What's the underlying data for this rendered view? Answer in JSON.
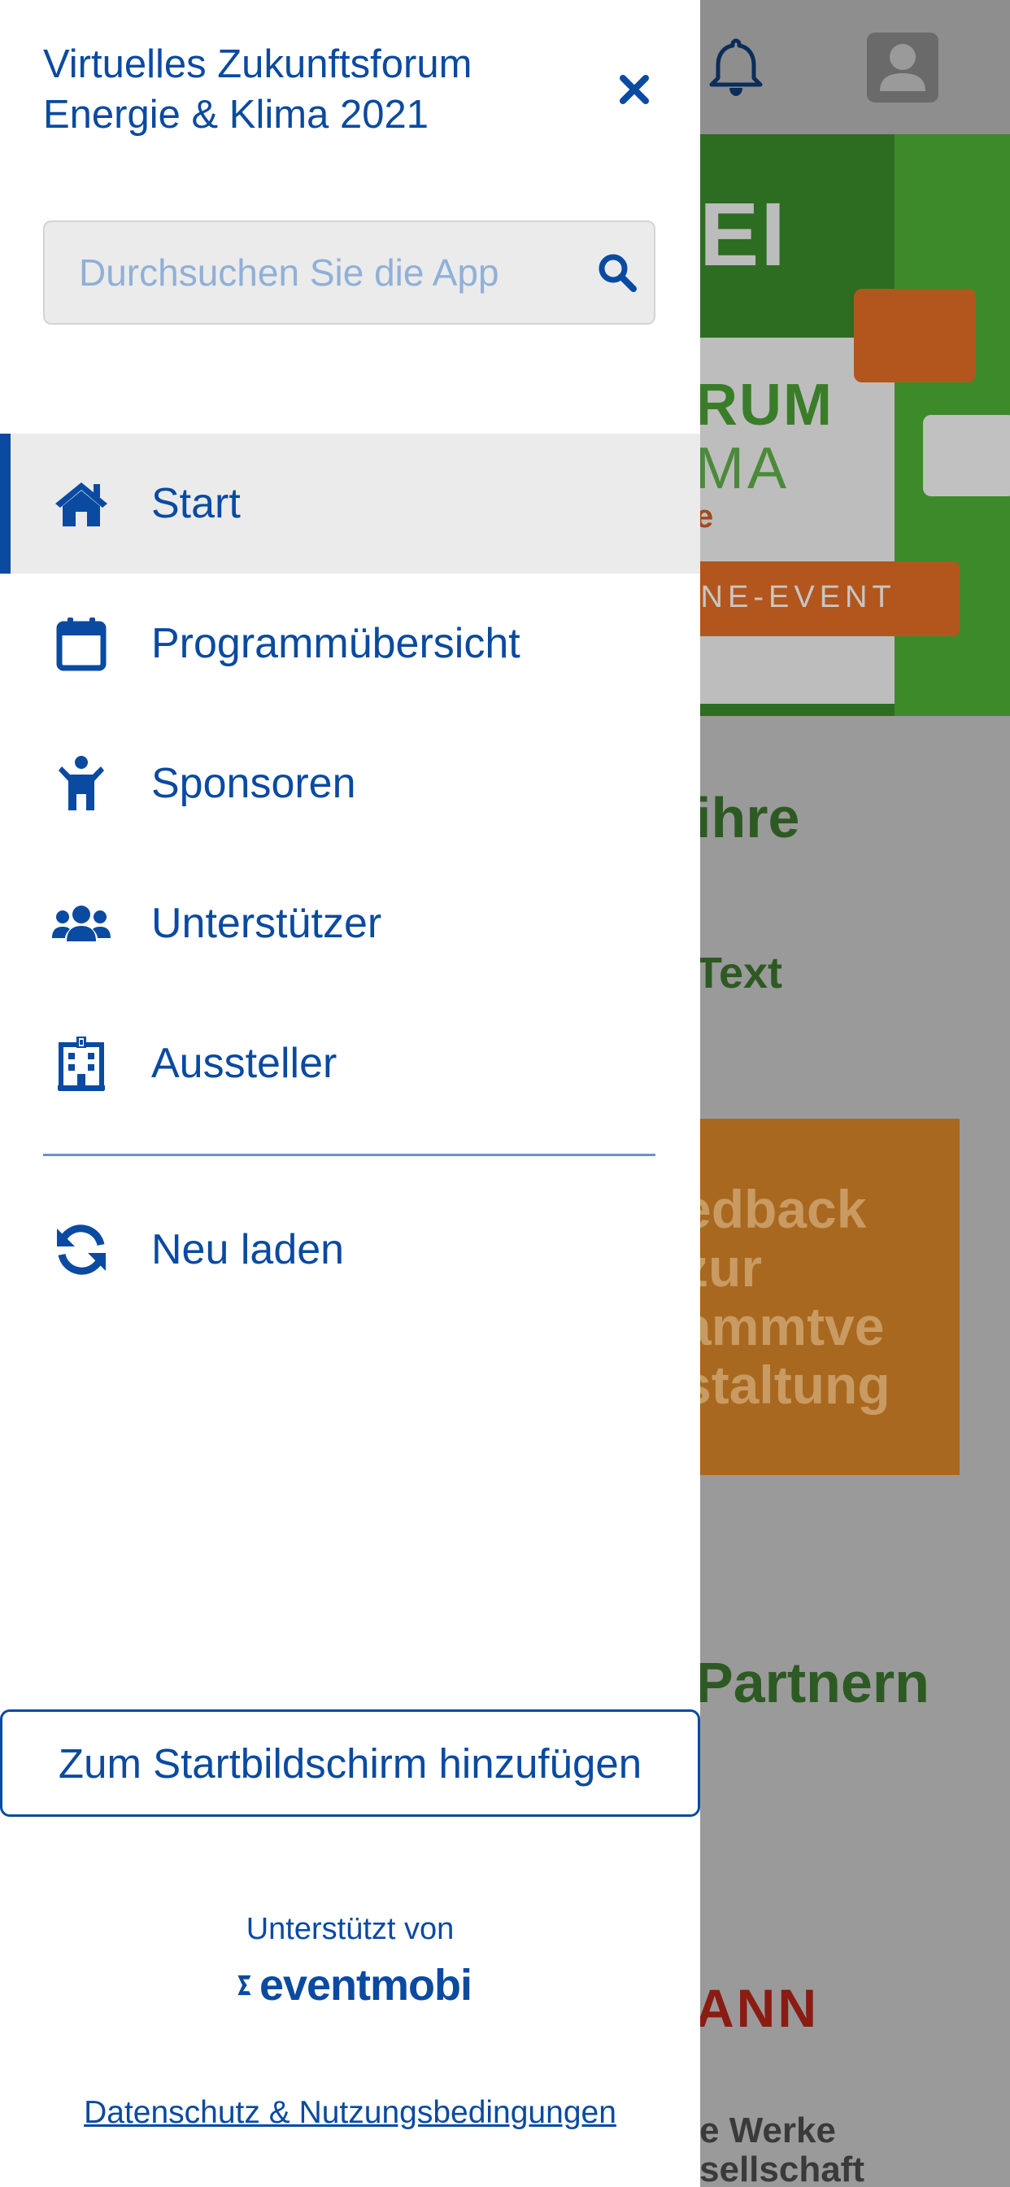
{
  "drawer": {
    "title": "Virtuelles Zukunftsforum\nEnergie & Klima 2021",
    "close_icon": "close-icon",
    "search": {
      "placeholder": "Durchsuchen Sie die App",
      "value": "",
      "icon": "search-icon"
    },
    "nav": [
      {
        "label": "Start",
        "icon": "home-icon",
        "active": true
      },
      {
        "label": "Programmübersicht",
        "icon": "calendar-icon",
        "active": false
      },
      {
        "label": "Sponsoren",
        "icon": "person-icon",
        "active": false
      },
      {
        "label": "Unterstützer",
        "icon": "users-icon",
        "active": false
      },
      {
        "label": "Aussteller",
        "icon": "building-icon",
        "active": false
      }
    ],
    "reload": {
      "label": "Neu laden",
      "icon": "refresh-icon"
    },
    "add_home_label": "Zum Startbildschirm hinzufügen",
    "powered_by": "Unterstützt von",
    "powered_brand": "eventmobi",
    "privacy_link": "Datenschutz & Nutzungsbedingungen"
  },
  "background": {
    "header_icons": [
      "bell-icon",
      "user-avatar-icon"
    ],
    "banner_big": "EI",
    "banner_forum": "RUM",
    "banner_klima": "MA",
    "banner_e": "e",
    "banner_button": "INE-EVENT",
    "heading1": "ihre",
    "text1": "Text",
    "feedback": "edback\nzur\nammtve\nstaltung",
    "heading2": "Partnern",
    "partner_logo": "ANN",
    "partner_werke": "e Werke\nsellschaft"
  },
  "colors": {
    "brand_blue": "#0a4aa1",
    "active_bg": "#ebebeb",
    "overlay_gray": "#9a9a9a",
    "divider": "#6f8fd0"
  }
}
